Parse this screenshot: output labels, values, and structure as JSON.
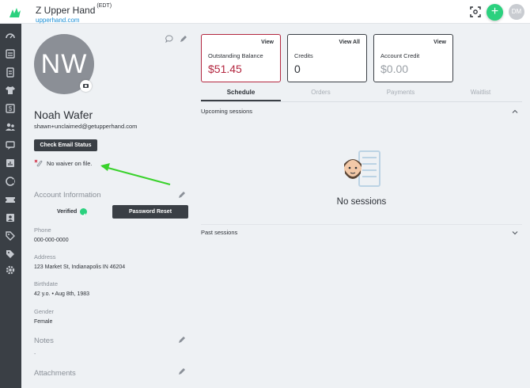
{
  "header": {
    "business_name": "Z Upper Hand",
    "timezone": "(EDT)",
    "url": "upperhand.com",
    "add_label": "+",
    "user_initials": "DM"
  },
  "sidebar": {
    "items": [
      "dashboard-icon",
      "calendar-icon",
      "clipboard-icon",
      "apparel-icon",
      "dollar-icon",
      "team-icon",
      "messages-icon",
      "reports-icon",
      "marketing-icon",
      "tickets-icon",
      "contacts-icon",
      "tags-icon",
      "coupons-icon",
      "settings-icon"
    ]
  },
  "profile": {
    "avatar_initials": "NW",
    "name": "Noah Wafer",
    "email": "shawn+unclaimed@getupperhand.com",
    "check_email_label": "Check Email Status",
    "waiver_text": "No waiver on file.",
    "account_info_title": "Account Information",
    "verified_label": "Verified",
    "password_reset_label": "Password Reset",
    "fields": [
      {
        "label": "Phone",
        "value": "000-000-0000"
      },
      {
        "label": "Address",
        "value": "123 Market St, Indianapolis IN 46204"
      },
      {
        "label": "Birthdate",
        "value": "42 y.o. • Aug 8th, 1983"
      },
      {
        "label": "Gender",
        "value": "Female"
      }
    ],
    "notes_title": "Notes",
    "notes_value": "-",
    "attachments_title": "Attachments"
  },
  "cards": [
    {
      "link": "View",
      "label": "Outstanding Balance",
      "value": "$51.45"
    },
    {
      "link": "View All",
      "label": "Credits",
      "value": "0"
    },
    {
      "link": "View",
      "label": "Account Credit",
      "value": "$0.00"
    }
  ],
  "tabs": [
    "Schedule",
    "Orders",
    "Payments",
    "Waitlist"
  ],
  "schedule": {
    "upcoming_title": "Upcoming sessions",
    "empty_text": "No sessions",
    "past_title": "Past sessions"
  },
  "colors": {
    "accent_green": "#2bd17e",
    "balance_red": "#b3263f",
    "nav_dark": "#3a3f45",
    "link_blue": "#1a8fd6"
  }
}
